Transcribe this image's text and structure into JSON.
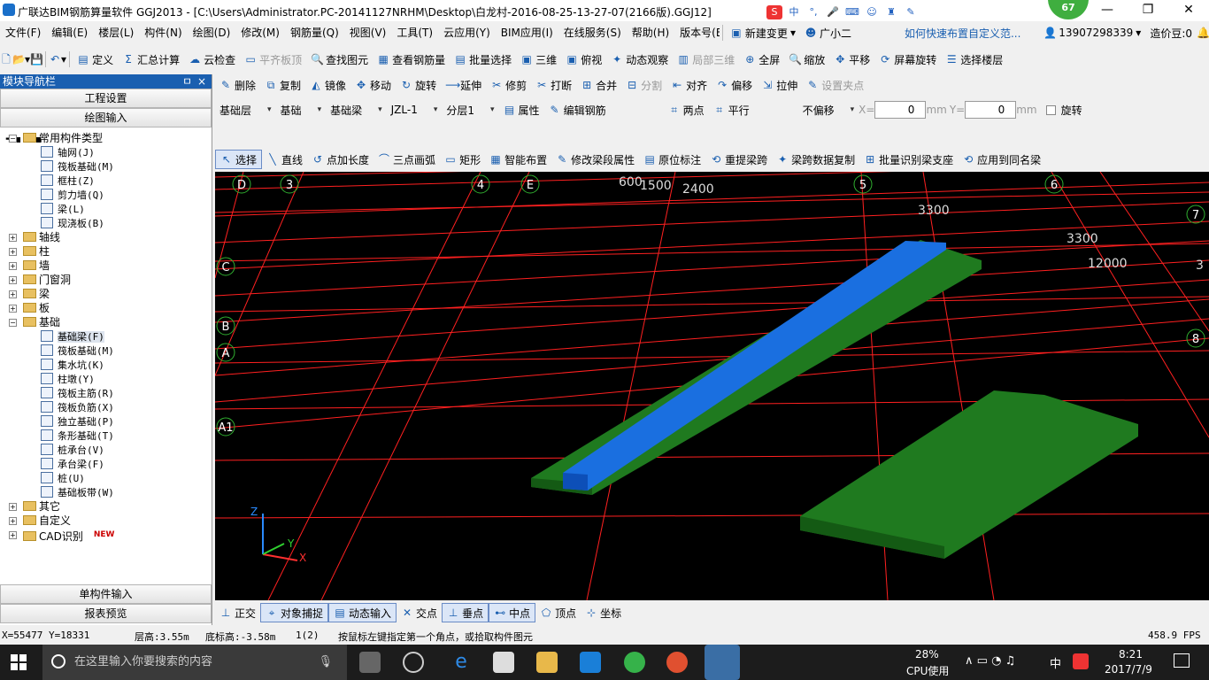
{
  "window": {
    "title": "广联达BIM钢筋算量软件 GGJ2013 - [C:\\Users\\Administrator.PC-20141127NRHM\\Desktop\\白龙村-2016-08-25-13-27-07(2166版).GGJ12]",
    "badge": "67",
    "ime_label": "中"
  },
  "menu": {
    "items": [
      "文件(F)",
      "编辑(E)",
      "楼层(L)",
      "构件(N)",
      "绘图(D)",
      "修改(M)",
      "钢筋量(Q)",
      "视图(V)",
      "工具(T)",
      "云应用(Y)",
      "BIM应用(I)",
      "在线服务(S)",
      "帮助(H)",
      "版本号(B)"
    ],
    "new_change": "新建变更",
    "xiaoer": "广小二",
    "tip": "如何快速布置自定义范...",
    "phone": "13907298339",
    "zaojiadou": "造价豆:0"
  },
  "toolbar1": [
    "定义",
    "汇总计算",
    "云检查",
    "平齐板顶",
    "查找图元",
    "查看钢筋量",
    "批量选择",
    "三维",
    "俯视",
    "动态观察",
    "局部三维",
    "全屏",
    "缩放",
    "平移",
    "屏幕旋转",
    "选择楼层"
  ],
  "toolbar2": [
    "删除",
    "复制",
    "镜像",
    "移动",
    "旋转",
    "延伸",
    "修剪",
    "打断",
    "合并",
    "分割",
    "对齐",
    "偏移",
    "拉伸",
    "设置夹点"
  ],
  "toolbar3": {
    "floor": "基础层",
    "category": "基础",
    "type": "基础梁",
    "name": "JZL-1",
    "layer": "分层1",
    "attr": "属性",
    "edit_rebar": "编辑钢筋",
    "twopoint": "两点",
    "parallel": "平行",
    "offset_mode": "不偏移",
    "x_label": "X=",
    "x_value": "0",
    "unit": "mm",
    "y_label": "Y=",
    "y_value": "0",
    "rotate": "旋转"
  },
  "toolbar4": [
    "选择",
    "直线",
    "点加长度",
    "三点画弧",
    "矩形",
    "智能布置",
    "修改梁段属性",
    "原位标注",
    "重提梁跨",
    "梁跨数据复制",
    "批量识别梁支座",
    "应用到同名梁"
  ],
  "left_panel": {
    "title": "模块导航栏",
    "pin": "ㅁ",
    "close": "×",
    "btn_settings": "工程设置",
    "btn_draw": "绘图输入",
    "btn_single": "单构件输入",
    "btn_report": "报表预览",
    "tree": [
      {
        "label": "常用构件类型",
        "level": 0,
        "kind": "folder",
        "open": true
      },
      {
        "label": "轴网(J)",
        "level": 1,
        "kind": "item"
      },
      {
        "label": "筏板基础(M)",
        "level": 1,
        "kind": "item"
      },
      {
        "label": "框柱(Z)",
        "level": 1,
        "kind": "item"
      },
      {
        "label": "剪力墙(Q)",
        "level": 1,
        "kind": "item"
      },
      {
        "label": "梁(L)",
        "level": 1,
        "kind": "item"
      },
      {
        "label": "现浇板(B)",
        "level": 1,
        "kind": "item"
      },
      {
        "label": "轴线",
        "level": 0,
        "kind": "folder",
        "open": false
      },
      {
        "label": "柱",
        "level": 0,
        "kind": "folder",
        "open": false
      },
      {
        "label": "墙",
        "level": 0,
        "kind": "folder",
        "open": false
      },
      {
        "label": "门窗洞",
        "level": 0,
        "kind": "folder",
        "open": false
      },
      {
        "label": "梁",
        "level": 0,
        "kind": "folder",
        "open": false
      },
      {
        "label": "板",
        "level": 0,
        "kind": "folder",
        "open": false
      },
      {
        "label": "基础",
        "level": 0,
        "kind": "folder",
        "open": true
      },
      {
        "label": "基础梁(F)",
        "level": 1,
        "kind": "item",
        "selected": true
      },
      {
        "label": "筏板基础(M)",
        "level": 1,
        "kind": "item"
      },
      {
        "label": "集水坑(K)",
        "level": 1,
        "kind": "item"
      },
      {
        "label": "柱墩(Y)",
        "level": 1,
        "kind": "item"
      },
      {
        "label": "筏板主筋(R)",
        "level": 1,
        "kind": "item"
      },
      {
        "label": "筏板负筋(X)",
        "level": 1,
        "kind": "item"
      },
      {
        "label": "独立基础(P)",
        "level": 1,
        "kind": "item"
      },
      {
        "label": "条形基础(T)",
        "level": 1,
        "kind": "item"
      },
      {
        "label": "桩承台(V)",
        "level": 1,
        "kind": "item"
      },
      {
        "label": "承台梁(F)",
        "level": 1,
        "kind": "item"
      },
      {
        "label": "桩(U)",
        "level": 1,
        "kind": "item"
      },
      {
        "label": "基础板带(W)",
        "level": 1,
        "kind": "item"
      },
      {
        "label": "其它",
        "level": 0,
        "kind": "folder",
        "open": false
      },
      {
        "label": "自定义",
        "level": 0,
        "kind": "folder",
        "open": false
      },
      {
        "label": "CAD识别",
        "level": 0,
        "kind": "folder",
        "open": false,
        "new": "NEW"
      }
    ]
  },
  "viewport": {
    "axis_labels": [
      "D",
      "3",
      "4",
      "E",
      "5",
      "6",
      "7",
      "C",
      "B",
      "A",
      "A1",
      "8"
    ],
    "dims": [
      "3300",
      "3300",
      "12000",
      "2400",
      "1500",
      "600",
      "3"
    ],
    "axes": {
      "x": "X",
      "y": "Y",
      "z": "Z"
    },
    "colors": {
      "background": "#000000",
      "grid": "#ff2020",
      "slab": "#1f7a1f",
      "beam": "#1a6fe0"
    }
  },
  "snapbar": [
    "正交",
    "对象捕捉",
    "动态输入",
    "交点",
    "垂点",
    "中点",
    "顶点",
    "坐标"
  ],
  "status": {
    "coords": "X=55477 Y=18331",
    "floor_height": "层高:3.55m",
    "bottom_elev": "底标高:-3.58m",
    "count": "1(2)",
    "hint": "按鼠标左键指定第一个角点，或拾取构件图元",
    "fps": "458.9 FPS"
  },
  "taskbar": {
    "search": "在这里输入你要搜索的内容",
    "cpu": "28%",
    "cpu_label": "CPU使用",
    "lang": "中",
    "time": "8:21",
    "date": "2017/7/9"
  }
}
